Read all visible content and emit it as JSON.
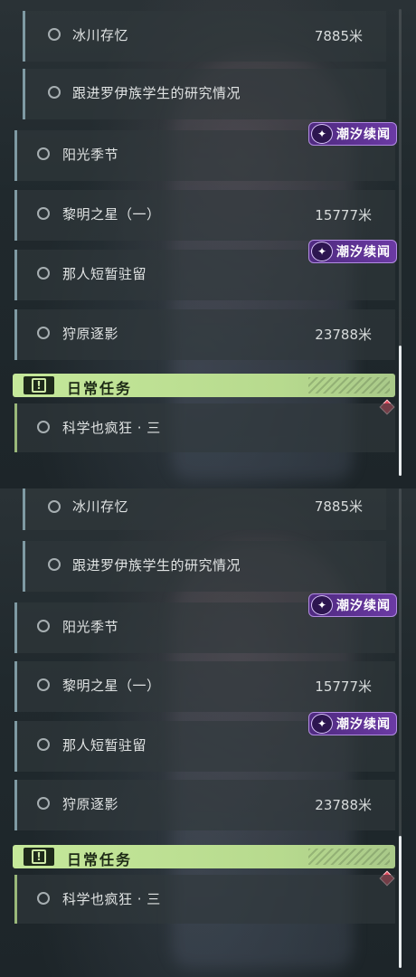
{
  "badge_text": "潮汐续闻",
  "daily_title": "日常任务",
  "tasks": {
    "binchuan": {
      "label": "冰川存忆",
      "distance": "7885米"
    },
    "luoyi": {
      "label": "跟进罗伊族学生的研究情况",
      "distance": ""
    },
    "yangguang": {
      "label": "阳光季节",
      "distance": ""
    },
    "liming": {
      "label": "黎明之星（一）",
      "distance": "15777米"
    },
    "naren": {
      "label": "那人短暂驻留",
      "distance": ""
    },
    "shouyuan": {
      "label": "狩原逐影",
      "distance": "23788米"
    },
    "kexue": {
      "label": "科学也疯狂 · 三",
      "distance": ""
    }
  },
  "icons": {
    "task_marker": "circle-outline-icon",
    "badge": "star-icon",
    "daily": "exclamation-icon",
    "alert": "red-diamond-icon"
  },
  "colors": {
    "badge_purple": "#6b3aa4",
    "daily_green": "#c5e89a",
    "card_accent": "#7f9aa3",
    "alert_red": "#e0465a"
  }
}
